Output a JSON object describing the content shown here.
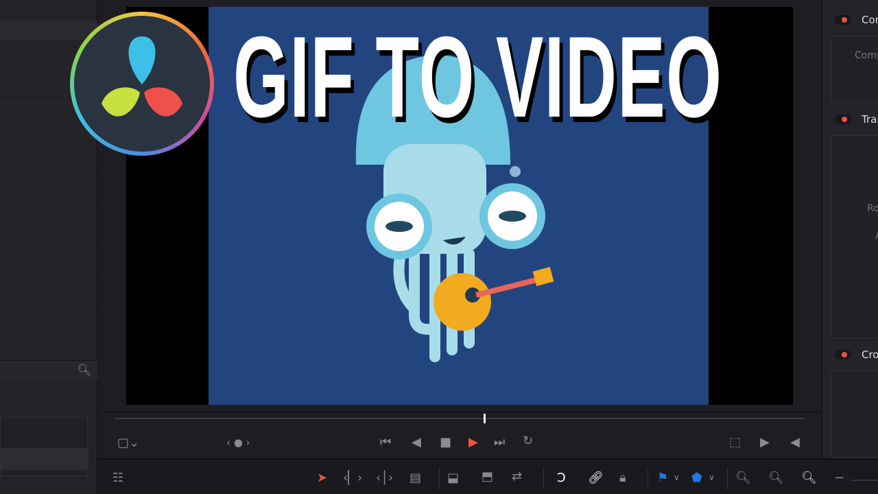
{
  "thumbnail": {
    "title": "GIF TO VIDEO",
    "logo": "DaVinci Resolve"
  },
  "inspector": {
    "sections": [
      {
        "label": "Con",
        "enabled": true
      },
      {
        "label": "Tran",
        "enabled": true
      },
      {
        "label": "Cro",
        "enabled": true
      }
    ],
    "composite_field": "Comp",
    "transform_fields": [
      "Ro",
      "A"
    ]
  },
  "viewer": {
    "playhead_fraction": 0.536,
    "background": "#224580"
  },
  "transport": {
    "icons": [
      "first-frame",
      "reverse",
      "stop",
      "play",
      "last-frame",
      "loop"
    ]
  },
  "colors": {
    "accent": "#e8553a",
    "flag": "#1f7ae0"
  }
}
